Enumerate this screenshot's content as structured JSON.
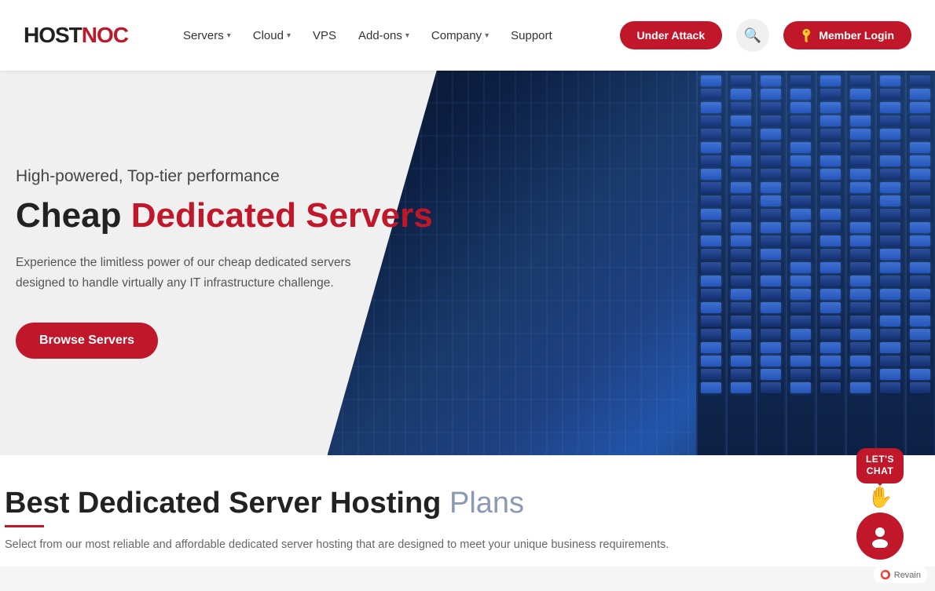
{
  "logo": {
    "host": "HOST",
    "noc": "NOC"
  },
  "nav": {
    "items": [
      {
        "label": "Servers",
        "hasDropdown": true
      },
      {
        "label": "Cloud",
        "hasDropdown": true
      },
      {
        "label": "VPS",
        "hasDropdown": false
      },
      {
        "label": "Add-ons",
        "hasDropdown": true
      },
      {
        "label": "Company",
        "hasDropdown": true
      },
      {
        "label": "Support",
        "hasDropdown": false
      }
    ],
    "under_attack_label": "Under Attack",
    "member_login_label": "Member Login"
  },
  "hero": {
    "subtitle": "High-powered, Top-tier performance",
    "title_plain": "Cheap ",
    "title_accent": "Dedicated Servers",
    "description": "Experience the limitless power of our cheap dedicated servers designed to handle virtually any IT infrastructure challenge.",
    "browse_button": "Browse Servers"
  },
  "bottom": {
    "title_plain": "Best Dedicated Server Hosting ",
    "title_accent": "Plans",
    "description": "Select from our most reliable and affordable dedicated server hosting that are designed to meet your unique business requirements."
  },
  "chat": {
    "bubble_label": "LET'S\nCHAT",
    "revain_label": "Revain"
  }
}
